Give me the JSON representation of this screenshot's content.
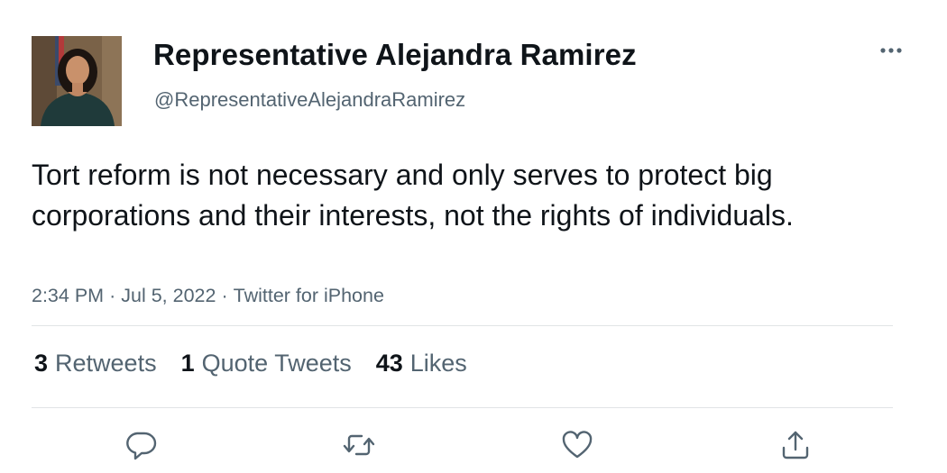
{
  "author": {
    "display_name": "Representative Alejandra Ramirez",
    "handle": "@RepresentativeAlejandraRamirez"
  },
  "tweet": {
    "text": "Tort reform is not necessary and only serves to protect big corporations and their interests, not the rights of individuals.",
    "time": "2:34 PM",
    "date": "Jul 5, 2022",
    "source": "Twitter for iPhone",
    "separator": "·"
  },
  "stats": [
    {
      "count": "3",
      "label": "Retweets"
    },
    {
      "count": "1",
      "label": "Quote Tweets"
    },
    {
      "count": "43",
      "label": "Likes"
    }
  ],
  "icons": {
    "more": "more-horizontal-icon",
    "reply": "reply-icon",
    "retweet": "retweet-icon",
    "like": "heart-icon",
    "share": "share-icon"
  },
  "colors": {
    "text_primary": "#0f1419",
    "text_secondary": "#536471",
    "divider": "#e1e4e6"
  }
}
